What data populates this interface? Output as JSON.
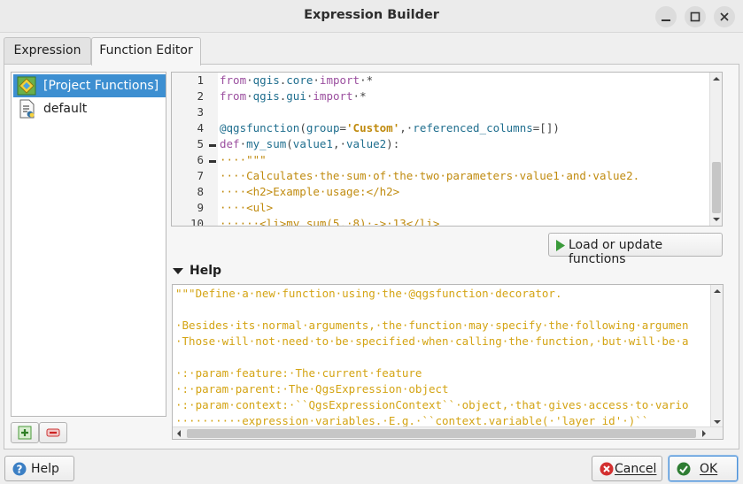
{
  "window": {
    "title": "Expression Builder"
  },
  "tabs": [
    {
      "label": "Expression",
      "active": false
    },
    {
      "label": "Function Editor",
      "active": true
    }
  ],
  "function_list": {
    "items": [
      {
        "label": "[Project Functions]",
        "selected": true,
        "icon": "project-functions-icon"
      },
      {
        "label": "default",
        "selected": false,
        "icon": "python-file-icon"
      }
    ]
  },
  "editor": {
    "line_numbers": [
      "1",
      "2",
      "3",
      "4",
      "5",
      "6",
      "7",
      "8",
      "9",
      "10"
    ],
    "lines": [
      "from·qgis.core·import·*",
      "from·qgis.gui·import·*",
      "",
      "@qgsfunction(group='Custom',·referenced_columns=[])",
      "def·my_sum(value1,·value2):",
      "····\"\"\"",
      "····Calculates·the·sum·of·the·two·parameters·value1·and·value2.",
      "····<h2>Example·usage:</h2>",
      "····<ul>",
      "······<li>my_sum(5,·8)·->·13</li>"
    ]
  },
  "buttons": {
    "load_update": "Load or update functions",
    "help": "Help",
    "cancel": "Cancel",
    "ok": "OK"
  },
  "help_section": {
    "title": "Help",
    "lines": [
      "\"\"\"Define·a·new·function·using·the·@qgsfunction·decorator.",
      "",
      "·Besides·its·normal·arguments,·the·function·may·specify·the·following·argumen",
      "·Those·will·not·need·to·be·specified·when·calling·the·function,·but·will·be·a",
      "",
      "·:·param·feature:·The·current·feature",
      "·:·param·parent:·The·QgsExpression·object",
      "·:·param·context:·``QgsExpressionContext``·object,·that·gives·access·to·vario",
      "··········expression·variables.·E.g.·``context.variable(·'layer_id'·)``"
    ]
  },
  "colors": {
    "keyword": "#9b4f9f",
    "identifier": "#1f6e8e",
    "string": "#c08b0f",
    "selection": "#3d8fd1",
    "help_text": "#d4a414"
  }
}
